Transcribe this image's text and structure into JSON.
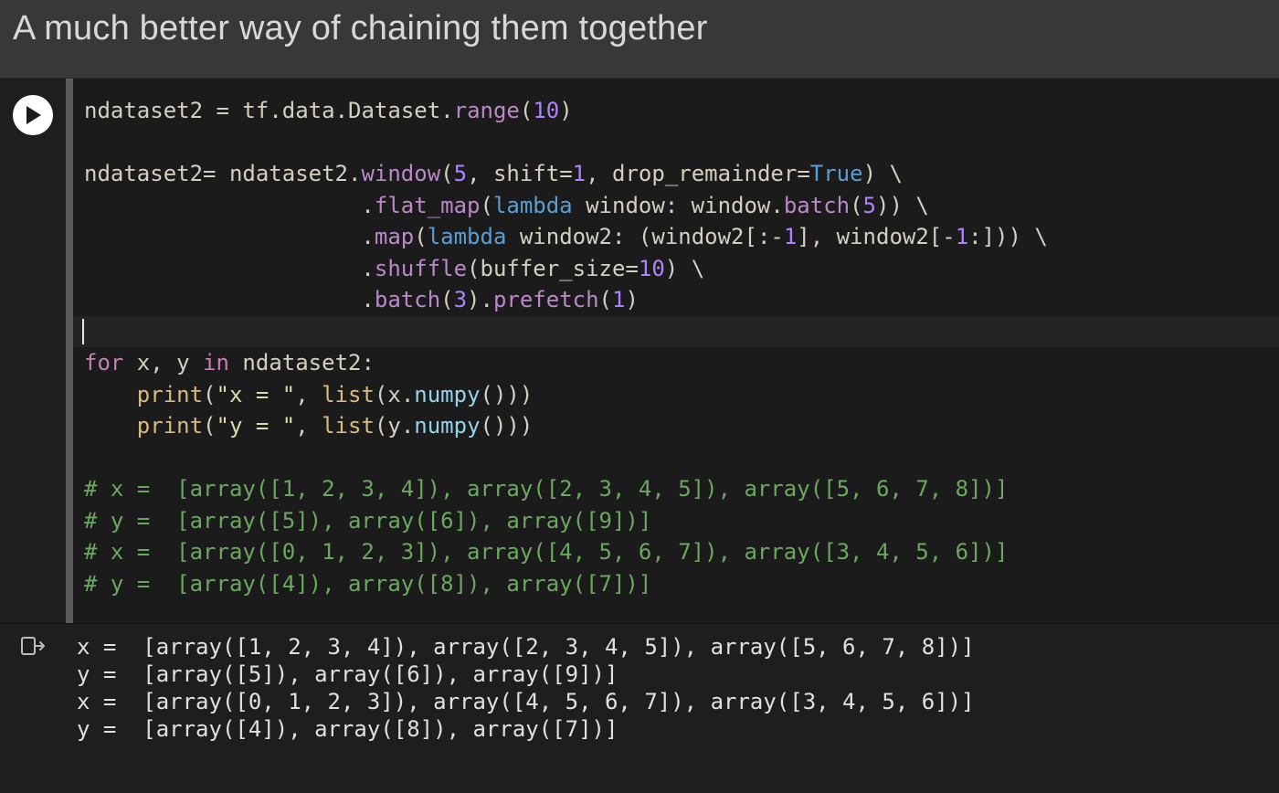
{
  "header": {
    "title": "A much better way of chaining them together"
  },
  "code": {
    "l1": {
      "a": "ndataset2 ",
      "b": "=",
      "c": " tf",
      "d": ".",
      "e": "data",
      "f": ".",
      "g": "Dataset",
      "h": ".",
      "i": "range",
      "j": "(",
      "k": "10",
      "l": ")"
    },
    "l2": {
      "a": "ndataset2",
      "b": "=",
      "c": " ndataset2",
      "d": ".",
      "e": "window",
      "f": "(",
      "g": "5",
      "h": ", shift",
      "i": "=",
      "j": "1",
      "k": ", drop_remainder",
      "l": "=",
      "m": "True",
      "n": ") \\"
    },
    "l3": {
      "pad": "                     .",
      "a": "flat_map",
      "b": "(",
      "c": "lambda",
      "d": " window: window",
      "e": ".",
      "f": "batch",
      "g": "(",
      "h": "5",
      "i": ")) \\"
    },
    "l4": {
      "pad": "                     .",
      "a": "map",
      "b": "(",
      "c": "lambda",
      "d": " window2: (window2[:",
      "e": "-",
      "f": "1",
      "g": "], window2[",
      "h": "-",
      "i": "1",
      "j": ":])) \\"
    },
    "l5": {
      "pad": "                     .",
      "a": "shuffle",
      "b": "(buffer_size",
      "c": "=",
      "d": "10",
      "e": ") \\"
    },
    "l6": {
      "pad": "                     .",
      "a": "batch",
      "b": "(",
      "c": "3",
      "d": ").",
      "e": "prefetch",
      "f": "(",
      "g": "1",
      "h": ")"
    },
    "l7": {
      "a": "for",
      "b": " x, y ",
      "c": "in",
      "d": " ndataset2:"
    },
    "l8": {
      "pad": "    ",
      "a": "print",
      "b": "(",
      "c": "\"x = \"",
      "d": ", ",
      "e": "list",
      "f": "(x",
      "g": ".",
      "h": "numpy",
      "i": "()))"
    },
    "l9": {
      "pad": "    ",
      "a": "print",
      "b": "(",
      "c": "\"y = \"",
      "d": ", ",
      "e": "list",
      "f": "(y",
      "g": ".",
      "h": "numpy",
      "i": "()))"
    },
    "cmt1": "# x =  [array([1, 2, 3, 4]), array([2, 3, 4, 5]), array([5, 6, 7, 8])]",
    "cmt2": "# y =  [array([5]), array([6]), array([9])]",
    "cmt3": "# x =  [array([0, 1, 2, 3]), array([4, 5, 6, 7]), array([3, 4, 5, 6])]",
    "cmt4": "# y =  [array([4]), array([8]), array([7])]"
  },
  "output": {
    "l1": "x =  [array([1, 2, 3, 4]), array([2, 3, 4, 5]), array([5, 6, 7, 8])]",
    "l2": "y =  [array([5]), array([6]), array([9])]",
    "l3": "x =  [array([0, 1, 2, 3]), array([4, 5, 6, 7]), array([3, 4, 5, 6])]",
    "l4": "y =  [array([4]), array([8]), array([7])]"
  },
  "colors": {
    "bg": "#1e1e1e",
    "code_bg": "#1b1b1b",
    "header_bg": "#383838",
    "accent_rail": "#5b5b5b",
    "run_btn": "#ffffff"
  }
}
